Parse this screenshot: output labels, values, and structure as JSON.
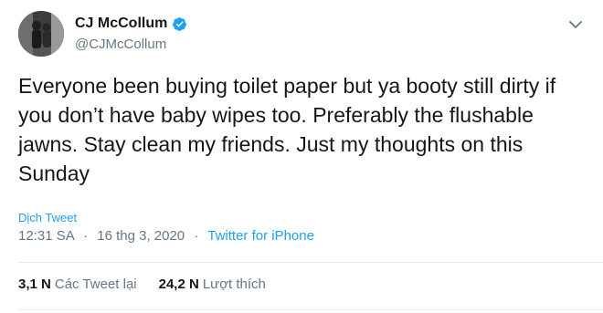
{
  "author": {
    "display_name": "CJ McCollum",
    "handle": "@CJMcCollum",
    "verified": true,
    "avatar_icon": "profile-photo",
    "verified_icon": "verified-badge-icon"
  },
  "menu_icon": "chevron-down-icon",
  "tweet": {
    "text": "Everyone been buying toilet paper but ya booty still dirty if you don’t have baby wipes too. Preferably the flushable jawns. Stay clean my friends. Just my thoughts on this Sunday"
  },
  "translate_label": "Dịch Tweet",
  "meta": {
    "time": "12:31 SA",
    "separator": "·",
    "date": "16 thg 3, 2020",
    "source": "Twitter for iPhone"
  },
  "stats": {
    "retweets": {
      "count": "3,1 N",
      "label": "Các Tweet lại"
    },
    "likes": {
      "count": "24,2 N",
      "label": "Lượt thích"
    }
  },
  "colors": {
    "text": "#14171a",
    "secondary": "#657786",
    "link": "#1da1f2",
    "verified": "#1da1f2",
    "divider": "#e6ecf0"
  }
}
